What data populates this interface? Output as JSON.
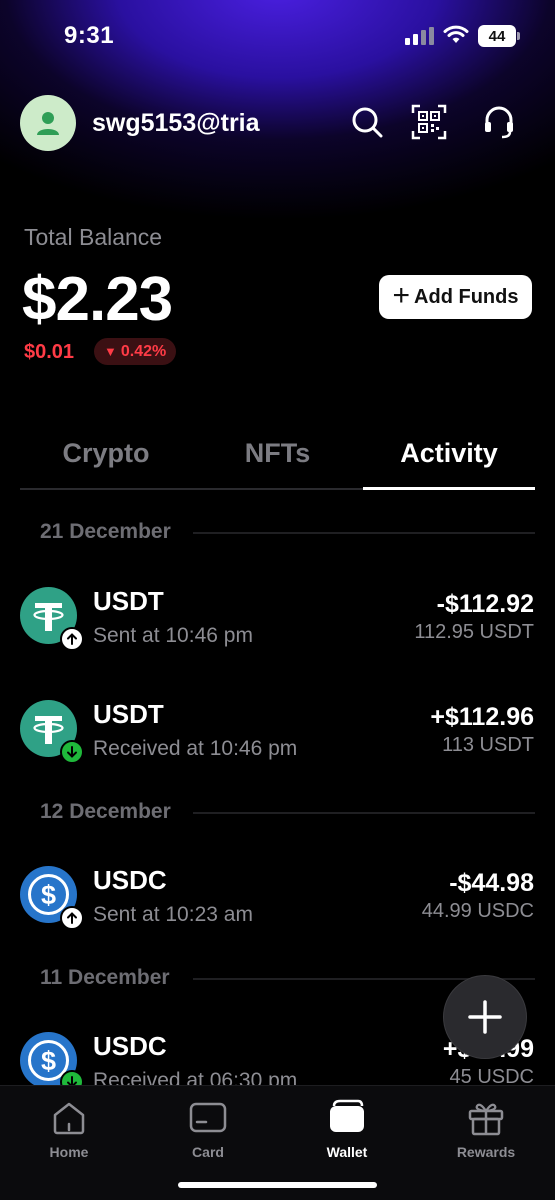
{
  "status_bar": {
    "time": "9:31",
    "battery": "44"
  },
  "header": {
    "username": "swg5153@tria"
  },
  "balance": {
    "label": "Total Balance",
    "value": "$2.23",
    "change": "$0.01",
    "change_pct": "0.42%",
    "add_funds_label": "Add Funds"
  },
  "tabs": [
    {
      "label": "Crypto",
      "active": false
    },
    {
      "label": "NFTs",
      "active": false
    },
    {
      "label": "Activity",
      "active": true
    }
  ],
  "activity": {
    "groups": [
      {
        "date": "21 December",
        "items": [
          {
            "token": "USDT",
            "direction": "sent",
            "subtitle": "Sent at 10:46 pm",
            "amount": "-$112.92",
            "quantity": "112.95 USDT"
          },
          {
            "token": "USDT",
            "direction": "received",
            "subtitle": "Received at 10:46 pm",
            "amount": "+$112.96",
            "quantity": "113 USDT"
          }
        ]
      },
      {
        "date": "12 December",
        "items": [
          {
            "token": "USDC",
            "direction": "sent",
            "subtitle": "Sent at 10:23 am",
            "amount": "-$44.98",
            "quantity": "44.99 USDC"
          }
        ]
      },
      {
        "date": "11 December",
        "items": [
          {
            "token": "USDC",
            "direction": "received",
            "subtitle": "Received at 06:30 pm",
            "amount": "+$44.99",
            "quantity": "45 USDC"
          }
        ]
      }
    ]
  },
  "bottom_nav": [
    {
      "label": "Home",
      "icon": "home-icon",
      "active": false
    },
    {
      "label": "Card",
      "icon": "card-icon",
      "active": false
    },
    {
      "label": "Wallet",
      "icon": "wallet-icon",
      "active": true
    },
    {
      "label": "Rewards",
      "icon": "gift-icon",
      "active": false
    }
  ],
  "colors": {
    "accent_glow": "#4a1fe0",
    "negative": "#ff3b46",
    "positive": "#1fb93b",
    "usdt": "#2fa186",
    "usdc": "#2775ca"
  }
}
